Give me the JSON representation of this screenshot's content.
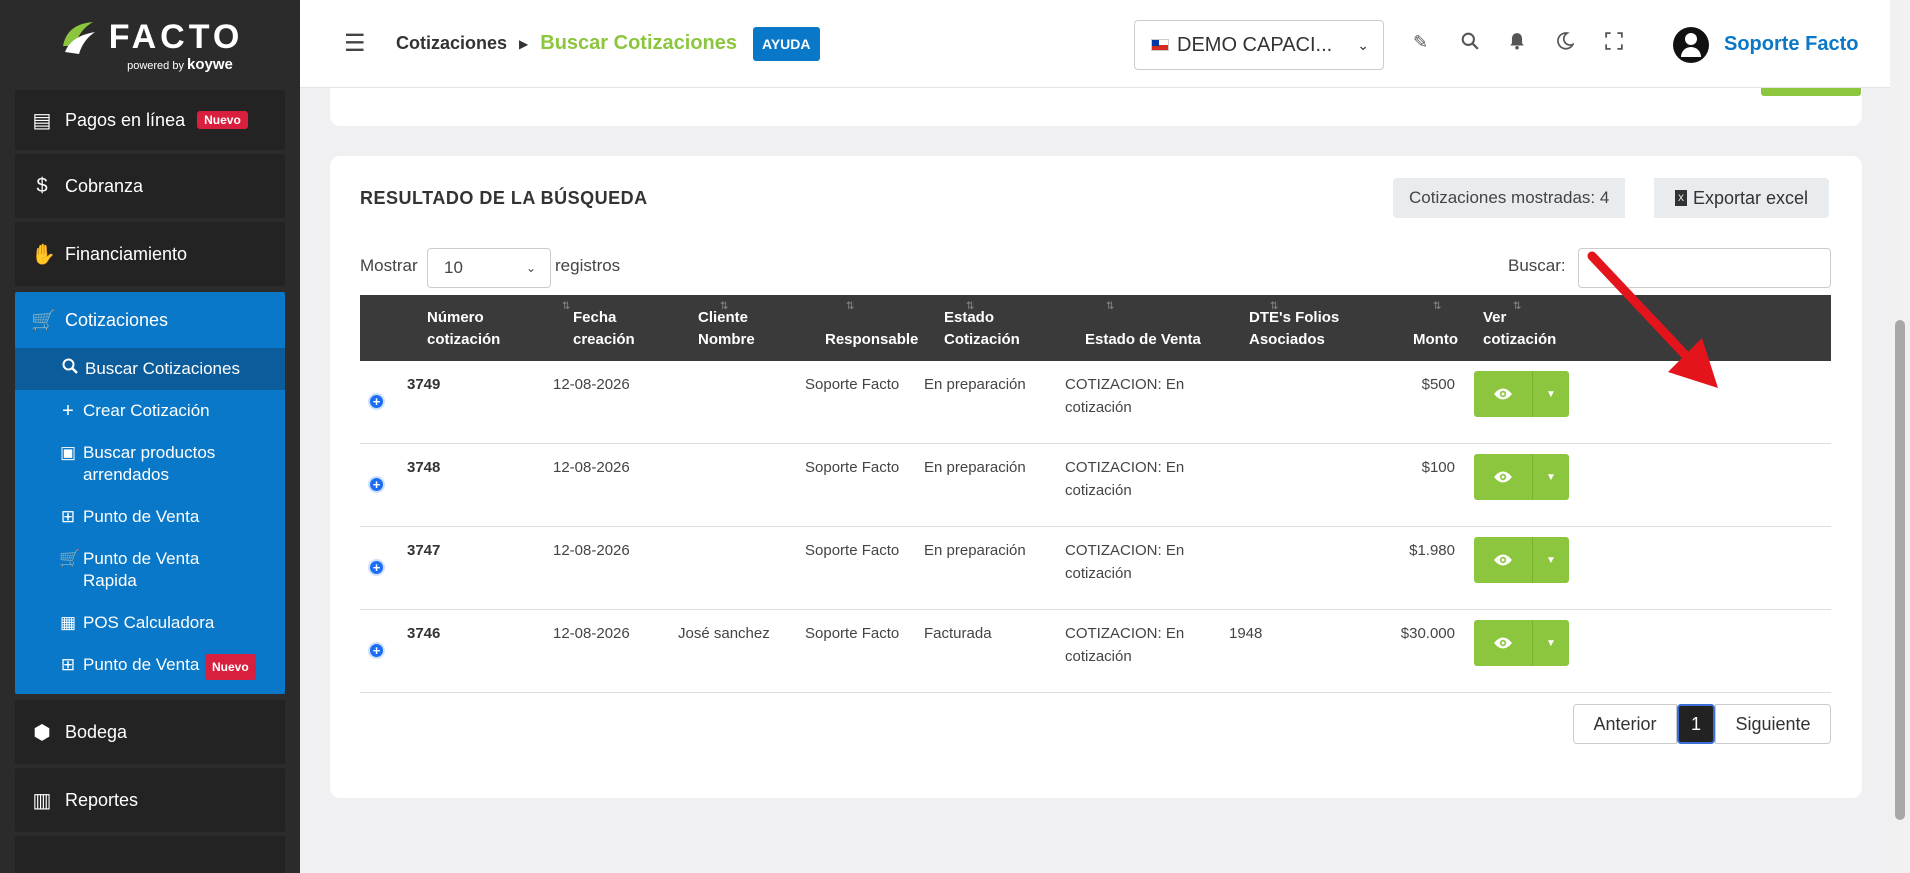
{
  "brand": {
    "name": "FACTO",
    "powered_by": "powered by",
    "partner": "koywe"
  },
  "sidebar": {
    "items_top": [
      {
        "label": "Pagos en línea",
        "badge": "Nuevo",
        "icon": "money-icon"
      },
      {
        "label": "Cobranza",
        "icon": "dollar-icon"
      },
      {
        "label": "Financiamiento",
        "icon": "hand-money-icon"
      }
    ],
    "group": {
      "label": "Cotizaciones",
      "icon": "cart-icon",
      "items": [
        {
          "label": "Buscar Cotizaciones",
          "icon": "search-icon"
        },
        {
          "label": "Crear Cotización",
          "icon": "plus-icon"
        },
        {
          "label": "Buscar productos arrendados",
          "icon": "clipboard-icon"
        },
        {
          "label": "Punto de Venta",
          "icon": "grid-icon"
        },
        {
          "label": "Punto de Venta Rapida",
          "icon": "cart-icon"
        },
        {
          "label": "POS Calculadora",
          "icon": "calculator-icon"
        },
        {
          "label": "Punto de Venta",
          "badge": "Nuevo",
          "icon": "grid-icon"
        }
      ]
    },
    "items_bottom": [
      {
        "label": "Bodega",
        "icon": "boxes-icon"
      },
      {
        "label": "Reportes",
        "icon": "chart-icon"
      }
    ]
  },
  "header": {
    "crumb1": "Cotizaciones",
    "crumb2": "Buscar Cotizaciones",
    "help": "AYUDA",
    "company": "DEMO CAPACI...",
    "user": "Soporte Facto"
  },
  "results": {
    "title": "RESULTADO DE LA BÚSQUEDA",
    "count": "Cotizaciones mostradas: 4",
    "export": "Exportar excel",
    "show_label": "Mostrar",
    "show_value": "10",
    "show_suffix": "registros",
    "search_label": "Buscar:",
    "columns": [
      "Número\ncotización",
      "Fecha\ncreación",
      "Cliente\nNombre",
      "Responsable",
      "Estado\nCotización",
      "Estado de Venta",
      "DTE's Folios\nAsociados",
      "Monto",
      "Ver\ncotización"
    ],
    "rows": [
      {
        "num": "3749",
        "fecha": "12-08-2026",
        "cliente": "",
        "responsable": "Soporte Facto",
        "estado": "En preparación",
        "venta": "COTIZACION: En cotización",
        "folios": "",
        "monto": "$500"
      },
      {
        "num": "3748",
        "fecha": "12-08-2026",
        "cliente": "",
        "responsable": "Soporte Facto",
        "estado": "En preparación",
        "venta": "COTIZACION: En cotización",
        "folios": "",
        "monto": "$100"
      },
      {
        "num": "3747",
        "fecha": "12-08-2026",
        "cliente": "",
        "responsable": "Soporte Facto",
        "estado": "En preparación",
        "venta": "COTIZACION: En cotización",
        "folios": "",
        "monto": "$1.980"
      },
      {
        "num": "3746",
        "fecha": "12-08-2026",
        "cliente": "José sanchez",
        "responsable": "Soporte Facto",
        "estado": "Facturada",
        "venta": "COTIZACION: En cotización",
        "folios": "1948",
        "monto": "$30.000"
      }
    ],
    "pager": {
      "prev": "Anterior",
      "current": "1",
      "next": "Siguiente"
    }
  },
  "colors": {
    "accent_blue": "#0a78c8",
    "accent_green": "#8cc63f",
    "badge_red": "#d8203e",
    "sidebar_bg": "#2b2b2b"
  }
}
